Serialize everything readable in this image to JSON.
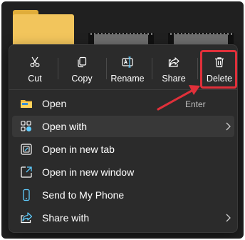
{
  "toolbar": {
    "cut": "Cut",
    "copy": "Copy",
    "rename": "Rename",
    "share": "Share",
    "delete": "Delete"
  },
  "items": [
    {
      "label": "Open",
      "shortcut": "Enter",
      "icon": "folder-icon"
    },
    {
      "label": "Open with",
      "icon": "apps-icon",
      "submenu": true
    },
    {
      "label": "Open in new tab",
      "icon": "new-tab-icon"
    },
    {
      "label": "Open in new window",
      "icon": "new-window-icon"
    },
    {
      "label": "Send to My Phone",
      "icon": "phone-icon"
    },
    {
      "label": "Share with",
      "icon": "share-icon",
      "submenu": true
    }
  ],
  "colors": {
    "menu_bg": "#2b2b2b",
    "highlight": "#e0303a",
    "accent": "#60cdff"
  }
}
